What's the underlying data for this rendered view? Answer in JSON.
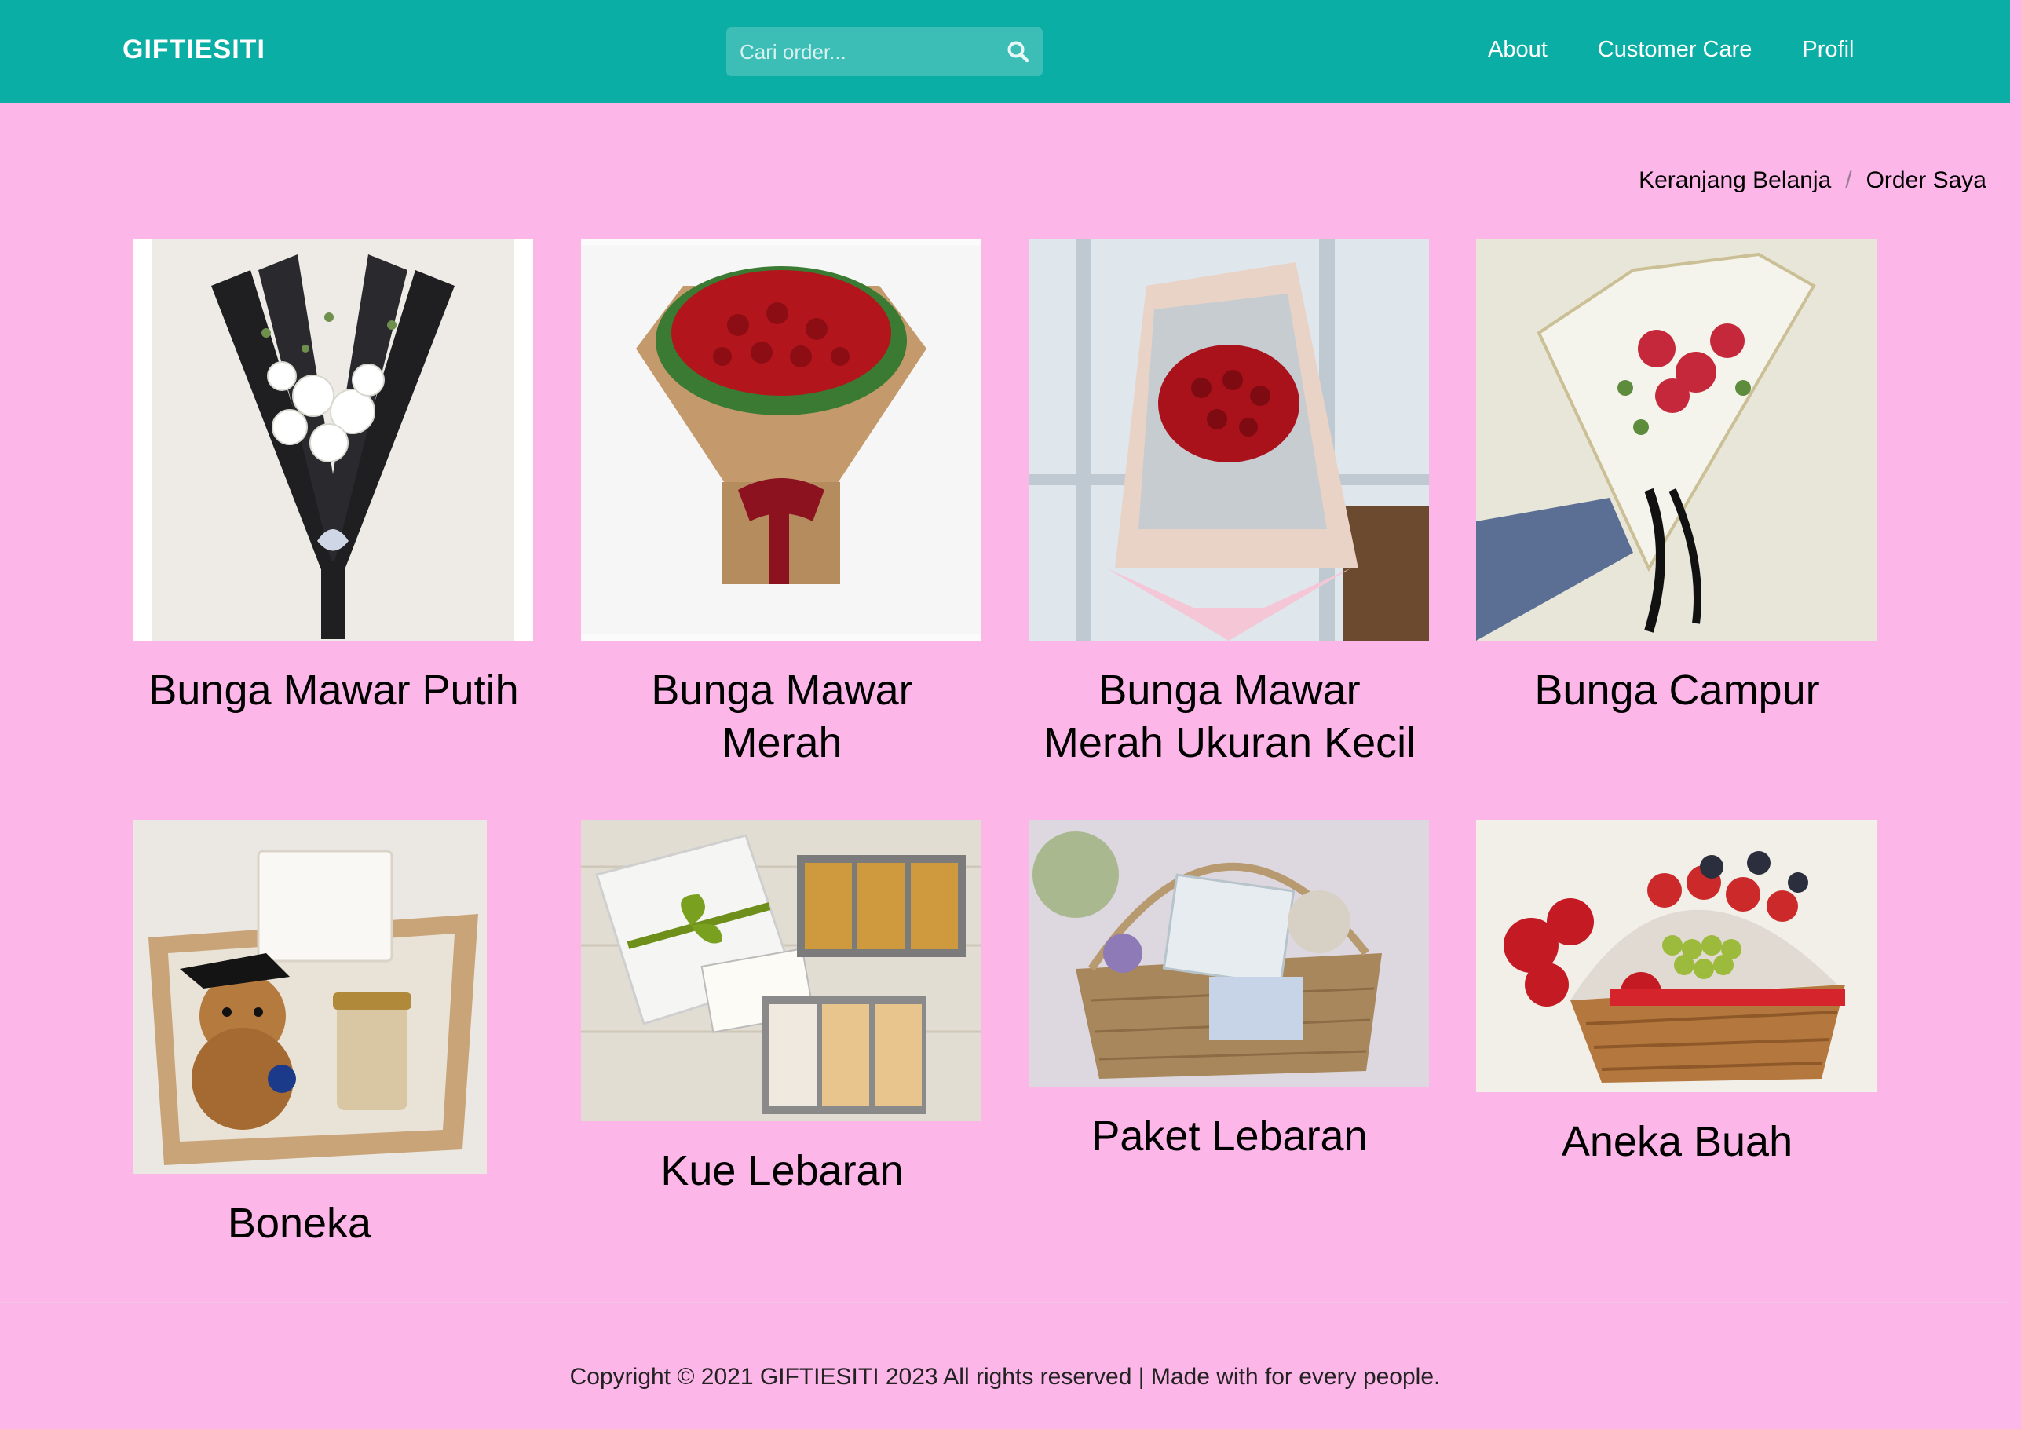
{
  "navbar": {
    "brand": "GIFTIESITI",
    "search_placeholder": "Cari order...",
    "links": [
      "About",
      "Customer Care",
      "Profil"
    ],
    "background": "#0aaea4"
  },
  "breadcrumb": {
    "items": [
      "Keranjang Belanja",
      "Order Saya"
    ],
    "separator": "/"
  },
  "products": [
    {
      "title": "Bunga Mawar Putih",
      "image_icon": "white-rose-bouquet"
    },
    {
      "title": "Bunga Mawar Merah",
      "image_icon": "red-rose-bouquet"
    },
    {
      "title": "Bunga Mawar Merah Ukuran Kecil",
      "image_icon": "small-red-rose-bouquet"
    },
    {
      "title": "Bunga Campur",
      "image_icon": "mixed-flower-bouquet"
    },
    {
      "title": "Boneka",
      "image_icon": "teddy-bear-box"
    },
    {
      "title": "Kue Lebaran",
      "image_icon": "cookie-boxes"
    },
    {
      "title": "Paket Lebaran",
      "image_icon": "gift-basket"
    },
    {
      "title": "Aneka Buah",
      "image_icon": "fruit-basket"
    }
  ],
  "footer": {
    "text": "Copyright © 2021 GIFTIESITI 2023 All rights reserved | Made with for every people."
  },
  "colors": {
    "page_background": "#fcb6e8",
    "nav_background": "#0aaea4",
    "search_background": "#3cbdb6"
  }
}
